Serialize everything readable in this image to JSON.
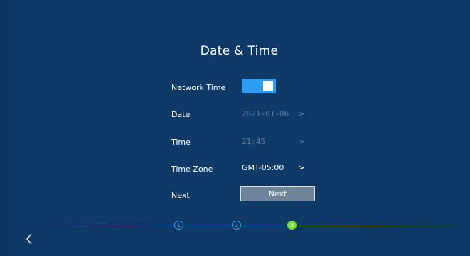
{
  "page": {
    "title": "Date & Time"
  },
  "rows": {
    "network_time": {
      "label": "Network Time",
      "enabled": true
    },
    "date": {
      "label": "Date",
      "value": "2021-01-06",
      "chevron": ">"
    },
    "time": {
      "label": "Time",
      "value": "21:45",
      "chevron": ">"
    },
    "time_zone": {
      "label": "Time Zone",
      "value": "GMT-05:00",
      "chevron": ">"
    },
    "next": {
      "label": "Next",
      "button_label": "Next"
    }
  },
  "steps": [
    {
      "number": "1",
      "state": "done"
    },
    {
      "number": "2",
      "state": "done"
    },
    {
      "number": "3",
      "state": "current"
    }
  ],
  "colors": {
    "background": "#0f3a67",
    "accent_blue": "#2e9cf2",
    "step_done": "#3aa0e8",
    "step_current": "#7ddb3a",
    "dim_text": "#5f7c9c"
  },
  "icons": {
    "back": "chevron-left-icon",
    "value_arrow": "chevron-right-icon"
  }
}
